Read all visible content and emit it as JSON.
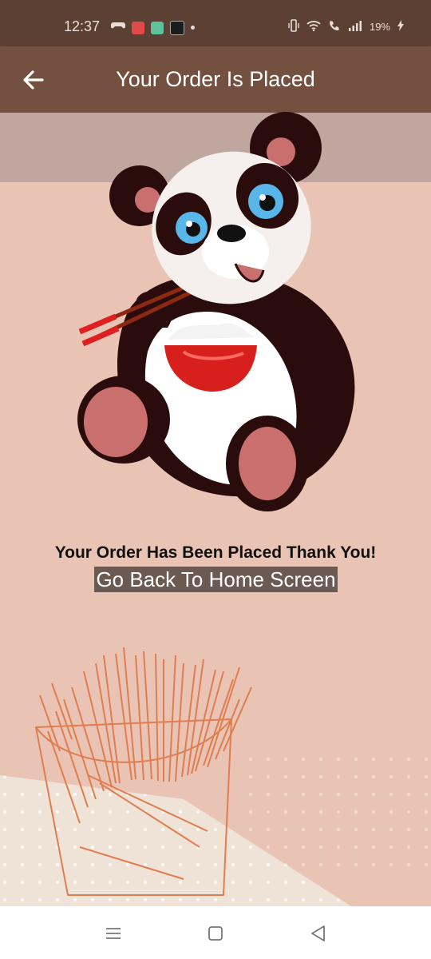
{
  "status_bar": {
    "time": "12:37",
    "battery": "19%",
    "icons": [
      "game-controller-icon",
      "app-red-icon",
      "app-green-icon",
      "app-dark-icon",
      "dot-icon",
      "vibrate-icon",
      "wifi-icon",
      "wifi-call-icon",
      "signal-icon",
      "battery-charging-icon"
    ]
  },
  "app_bar": {
    "title": "Your Order Is Placed",
    "back_icon": "arrow-left-icon"
  },
  "main": {
    "message": "Your Order Has Been Placed Thank You!",
    "home_button": "Go Back To Home Screen",
    "illustration": "panda-eating-rice",
    "background_illustration": "french-fries"
  },
  "nav_bar": {
    "icons": [
      "menu-icon",
      "home-square-icon",
      "back-triangle-icon"
    ]
  },
  "colors": {
    "status_bar": "#5b4033",
    "app_bar": "#73503f",
    "background": "#e9c4b5",
    "button_bg": "#6b5a52",
    "fries": "#e07d4f"
  }
}
